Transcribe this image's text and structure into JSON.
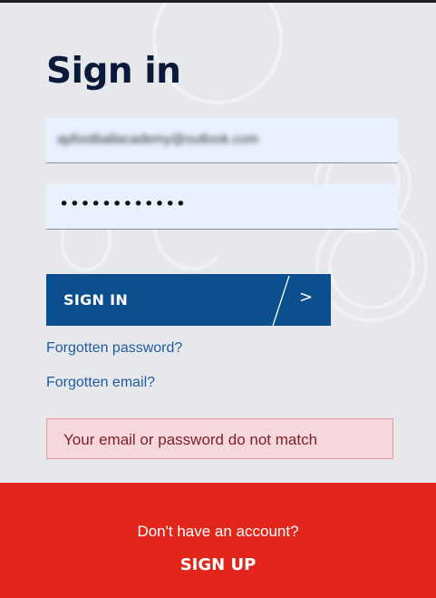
{
  "page": {
    "title": "Sign in"
  },
  "form": {
    "email_value": "apfootballacademy@outlook.com",
    "password_value": "••••••••••••",
    "submit_label": "SIGN IN",
    "submit_arrow": ">"
  },
  "links": {
    "forgotten_password": "Forgotten password?",
    "forgotten_email": "Forgotten email?"
  },
  "error": {
    "message": "Your email or password do not match"
  },
  "footer": {
    "prompt": "Don't have an account?",
    "signup_label": "SIGN UP"
  },
  "colors": {
    "background": "#e6e8ec",
    "title": "#0c1a3a",
    "button": "#0b4f8f",
    "link": "#1f5b9c",
    "error_bg": "#f6d7db",
    "error_text": "#7d1f2a",
    "footer": "#e2261b"
  }
}
